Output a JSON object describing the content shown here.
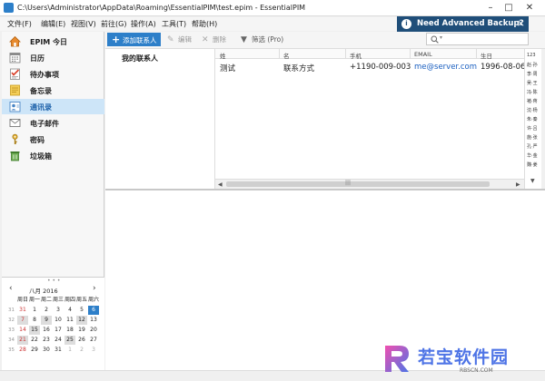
{
  "window": {
    "title": "C:\\Users\\Administrator\\AppData\\Roaming\\EssentialPIM\\test.epim - EssentialPIM",
    "minimize": "–",
    "maximize": "□",
    "close": "✕"
  },
  "menu": [
    "文件(F)",
    "编辑(E)",
    "视图(V)",
    "前往(G)",
    "操作(A)",
    "工具(T)",
    "帮助(H)"
  ],
  "promo": {
    "label": "Need Advanced Backup?",
    "close": "×",
    "icon": "info-icon"
  },
  "sidebar": {
    "items": [
      {
        "label": "EPIM 今日",
        "icon": "home-icon",
        "selected": false
      },
      {
        "label": "日历",
        "icon": "calendar-icon",
        "selected": false
      },
      {
        "label": "待办事项",
        "icon": "checklist-icon",
        "selected": false
      },
      {
        "label": "备忘录",
        "icon": "notes-icon",
        "selected": false
      },
      {
        "label": "通讯录",
        "icon": "contacts-icon",
        "selected": true
      },
      {
        "label": "电子邮件",
        "icon": "email-icon",
        "selected": false
      },
      {
        "label": "密码",
        "icon": "key-icon",
        "selected": false
      },
      {
        "label": "垃圾箱",
        "icon": "trash-icon",
        "selected": false
      }
    ]
  },
  "calendar": {
    "title": "八月 2016",
    "prev": "‹",
    "next": "›",
    "weekdays": [
      "周日",
      "周一",
      "周二",
      "周三",
      "周四",
      "周五",
      "周六"
    ],
    "weeks": [
      {
        "wk": "31",
        "days": [
          "31",
          "1",
          "2",
          "3",
          "4",
          "5",
          "6"
        ]
      },
      {
        "wk": "32",
        "days": [
          "7",
          "8",
          "9",
          "10",
          "11",
          "12",
          "13"
        ]
      },
      {
        "wk": "33",
        "days": [
          "14",
          "15",
          "16",
          "17",
          "18",
          "19",
          "20"
        ]
      },
      {
        "wk": "34",
        "days": [
          "21",
          "22",
          "23",
          "24",
          "25",
          "26",
          "27"
        ]
      },
      {
        "wk": "35",
        "days": [
          "28",
          "29",
          "30",
          "31",
          "1",
          "2",
          "3"
        ]
      }
    ],
    "today": "6"
  },
  "toolbar": {
    "add_label": "添加联系人",
    "edit_label": "编辑",
    "delete_label": "删除",
    "filter_label": "筛选 (Pro)",
    "search_placeholder": "",
    "search_icon": "search-icon"
  },
  "groups": {
    "label": "我的联系人"
  },
  "grid": {
    "columns": [
      "姓",
      "名",
      "手机",
      "EMAIL",
      "生日"
    ],
    "rows": [
      {
        "last": "测试",
        "first": "联系方式",
        "mobile": "+1190-009-003",
        "email": "me@server.com",
        "birthday": "1996-08-06"
      }
    ],
    "scroll_grip": "|||"
  },
  "alphabet": [
    "123",
    "赵·孙",
    "李·周",
    "吴·王",
    "冯·陈",
    "褚·蒋",
    "沈·杨",
    "朱·秦",
    "许·吕",
    "施·张",
    "孔·严",
    "华·金",
    "魏·姜"
  ],
  "watermark": {
    "text": "若宝软件园",
    "url": "RBSCN.COM"
  }
}
